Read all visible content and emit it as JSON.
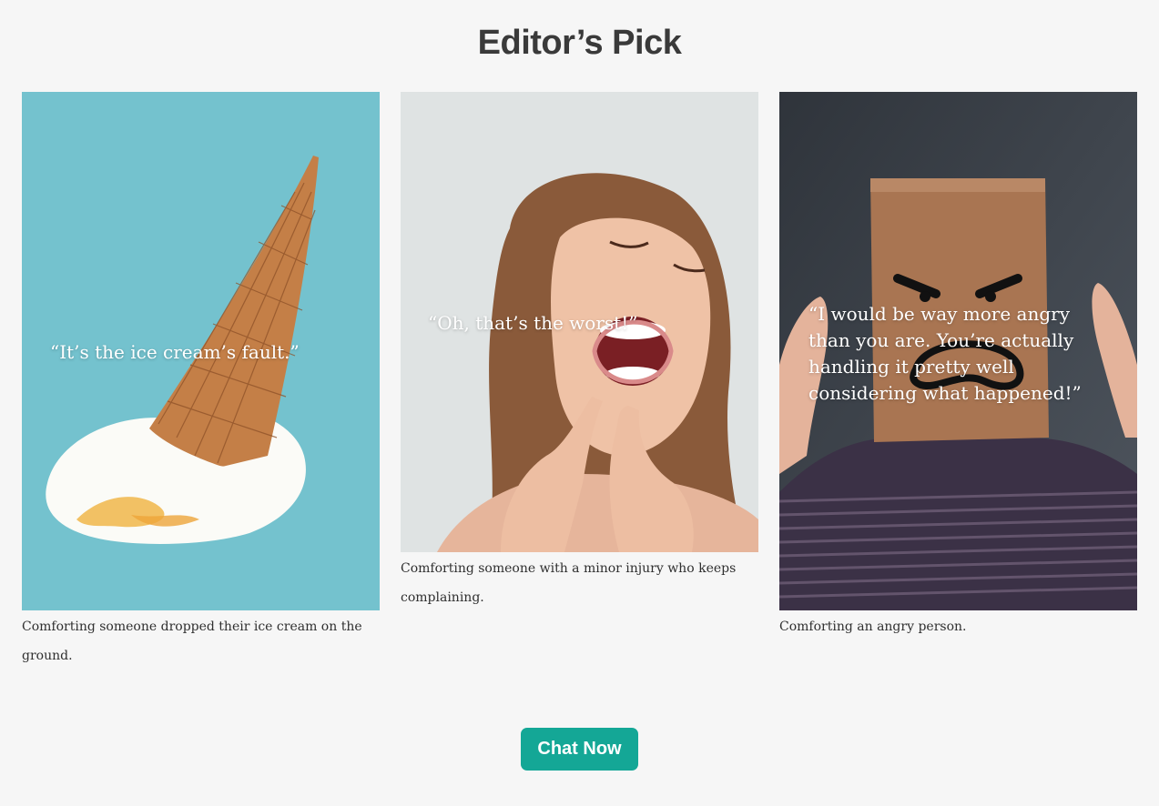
{
  "page": {
    "title": "Editor’s Pick"
  },
  "cards": [
    {
      "quote": "“It’s the ice cream’s fault.”",
      "caption": "Comforting someone dropped their ice cream on the ground.",
      "image": "melted-ice-cream-cone-photo"
    },
    {
      "quote": "“Oh, that’s the worst!”",
      "caption": "Comforting someone with a minor injury who keeps complaining.",
      "image": "woman-screaming-pimple-photo"
    },
    {
      "quote": "“I would be way more angry than you are. You’re actually handling it pretty well considering what happened!”",
      "caption": "Comforting an angry person.",
      "image": "angry-paper-bag-person-photo"
    }
  ],
  "cta": {
    "label": "Chat Now",
    "color": "#14a796"
  },
  "colors": {
    "background": "#f6f6f6",
    "title": "#3a3a3a"
  }
}
